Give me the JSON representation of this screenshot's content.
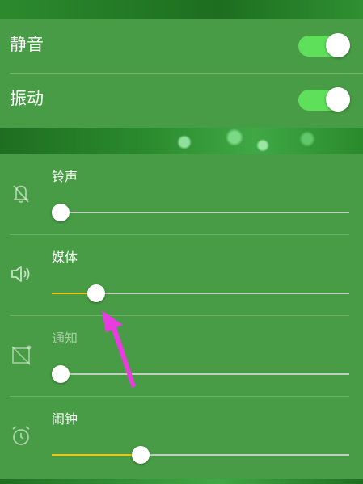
{
  "toggles": {
    "mute": {
      "label": "静音",
      "on": true
    },
    "vibrate": {
      "label": "振动",
      "on": true
    }
  },
  "volumes": [
    {
      "key": "ring",
      "label": "铃声",
      "icon": "bell-muted-icon",
      "level": 0.02,
      "enabled": true
    },
    {
      "key": "media",
      "label": "媒体",
      "icon": "speaker-icon",
      "level": 0.15,
      "enabled": true
    },
    {
      "key": "notify",
      "label": "通知",
      "icon": "notification-muted-icon",
      "level": 0.02,
      "enabled": false
    },
    {
      "key": "alarm",
      "label": "闹钟",
      "icon": "alarm-clock-icon",
      "level": 0.3,
      "enabled": true
    }
  ],
  "colors": {
    "panel": "#489c45",
    "switch_on": "#5ee05a",
    "slider_fill": "#f2c318",
    "annotation_arrow": "#e83ce0"
  }
}
